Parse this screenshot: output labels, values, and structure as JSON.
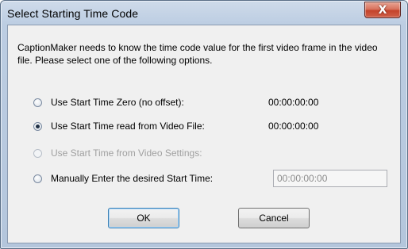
{
  "window": {
    "title": "Select Starting Time Code"
  },
  "intro": "CaptionMaker needs to know the time code value for the first video frame in the video file. Please select one of the following options.",
  "options": [
    {
      "label": "Use Start Time Zero (no offset):",
      "value": "00:00:00:00",
      "checked": false,
      "enabled": true
    },
    {
      "label": "Use Start Time read from Video File:",
      "value": "00:00:00:00",
      "checked": true,
      "enabled": true
    },
    {
      "label": "Use Start Time from Video Settings:",
      "value": "",
      "checked": false,
      "enabled": false
    },
    {
      "label": "Manually Enter the desired Start Time:",
      "value": "",
      "checked": false,
      "enabled": true
    }
  ],
  "manual_time": {
    "value": "00:00:00:00"
  },
  "buttons": {
    "ok": "OK",
    "cancel": "Cancel",
    "close": "X"
  },
  "colors": {
    "close_button": "#c4432a",
    "title_bar": "#bccde2",
    "dialog_bg": "#f0f0f0"
  }
}
